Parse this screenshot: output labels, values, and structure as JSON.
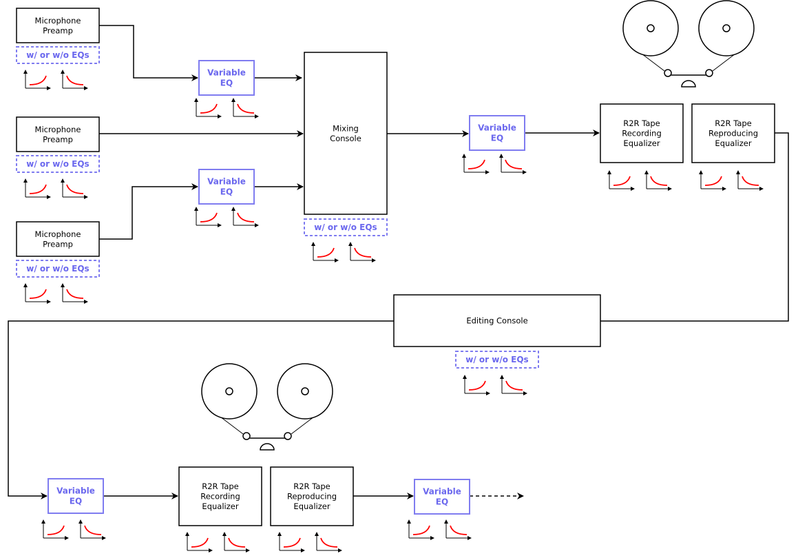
{
  "labels": {
    "mic_preamp": [
      "Microphone",
      "Preamp"
    ],
    "variable_eq": [
      "Variable",
      "EQ"
    ],
    "mixing_console": [
      "Mixing",
      "Console"
    ],
    "r2r_recording": [
      "R2R Tape",
      "Recording",
      "Equalizer"
    ],
    "r2r_reproducing": [
      "R2R Tape",
      "Reproducing",
      "Equalizer"
    ],
    "editing_console": "Editing Console",
    "eq_option": "w/ or w/o EQs"
  },
  "colors": {
    "eq_accent": "#6b68ee",
    "curve": "#ff0000"
  },
  "icons": [
    "rising-eq-curve-icon",
    "falling-eq-curve-icon",
    "tape-reel-icon"
  ]
}
